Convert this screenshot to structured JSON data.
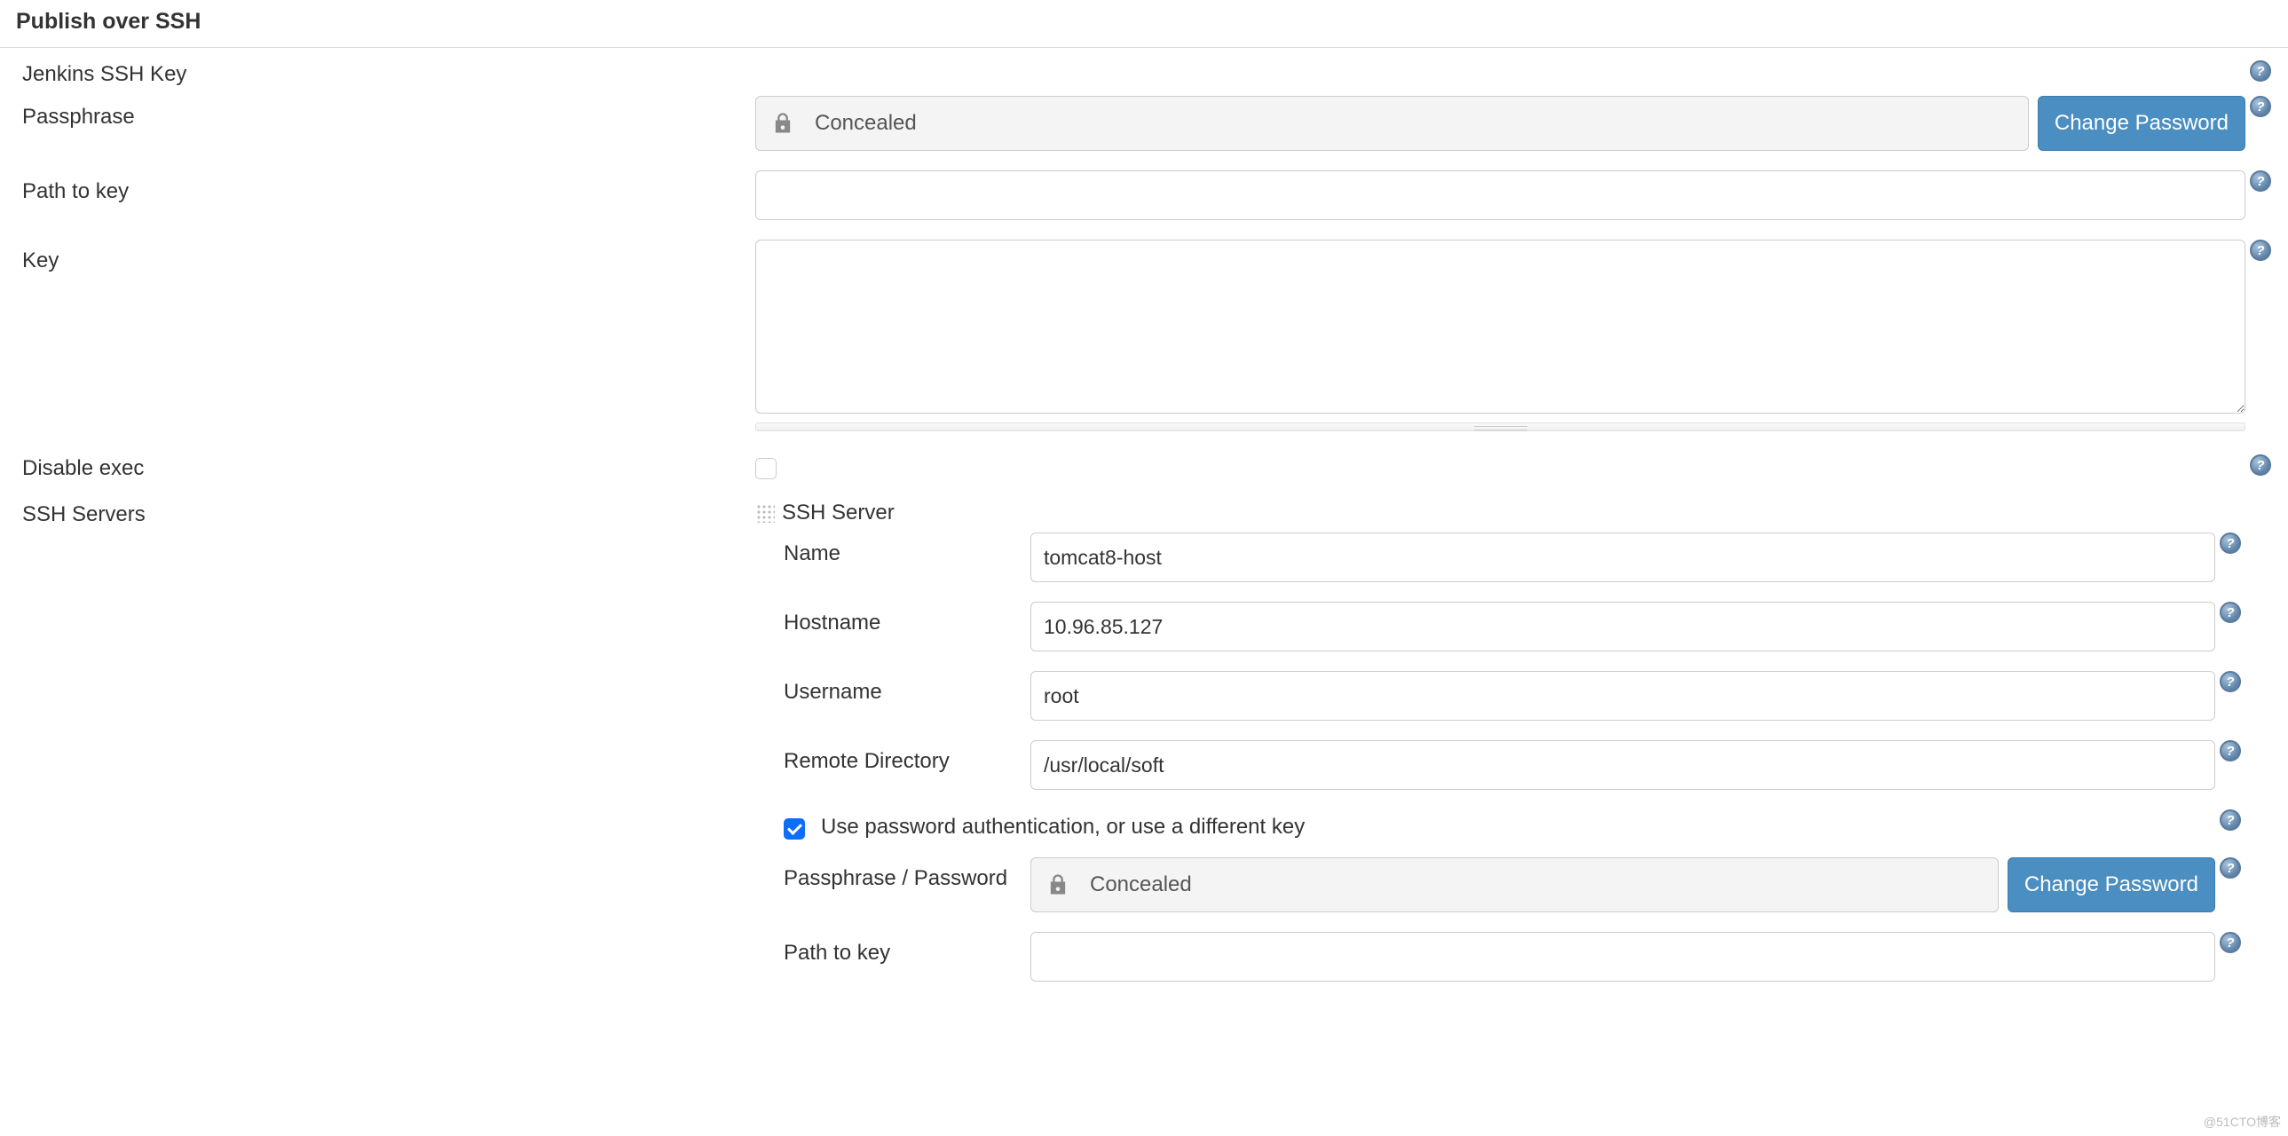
{
  "section": {
    "title": "Publish over SSH",
    "ssh_key_label": "Jenkins SSH Key"
  },
  "fields": {
    "passphrase": {
      "label": "Passphrase",
      "value": "Concealed",
      "button": "Change Password"
    },
    "path_to_key": {
      "label": "Path to key",
      "value": ""
    },
    "key": {
      "label": "Key",
      "value": ""
    },
    "disable_exec": {
      "label": "Disable exec",
      "checked": false
    },
    "ssh_servers_label": "SSH Servers"
  },
  "server": {
    "header": "SSH Server",
    "name": {
      "label": "Name",
      "value": "tomcat8-host"
    },
    "hostname": {
      "label": "Hostname",
      "value": "10.96.85.127"
    },
    "username": {
      "label": "Username",
      "value": "root"
    },
    "remote_directory": {
      "label": "Remote Directory",
      "value": "/usr/local/soft"
    },
    "use_password": {
      "label": "Use password authentication, or use a different key",
      "checked": true
    },
    "passphrase": {
      "label": "Passphrase / Password",
      "value": "Concealed",
      "button": "Change Password"
    },
    "path_to_key": {
      "label": "Path to key",
      "value": ""
    }
  },
  "watermark": "@51CTO博客"
}
